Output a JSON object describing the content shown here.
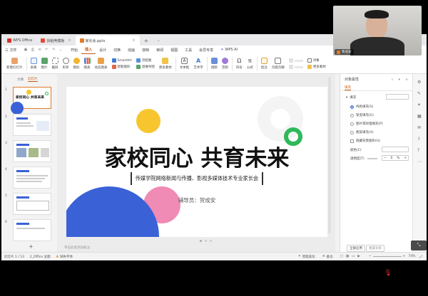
{
  "tabs": [
    {
      "label": "WPS Office",
      "color": "#d0312d"
    },
    {
      "label": "找稻壳模板",
      "color": "#e04a3a"
    },
    {
      "label": "家长会.pptx",
      "color": "#e07b2a"
    }
  ],
  "menus": [
    "三 文件",
    "开始",
    "插入",
    "设计",
    "切换",
    "动画",
    "放映",
    "审阅",
    "视图",
    "工具",
    "会员专享",
    "WPS AI"
  ],
  "ribbon": {
    "new_slide": "新建幻灯片",
    "table": "表格",
    "picture": "图片",
    "screenshot": "截屏",
    "shape": "形状",
    "icon": "图标",
    "chart": "图表",
    "dynamic_chart": "动态图表",
    "smartart": "SmartArt",
    "smart_shape": "智能图形",
    "flowchart": "流程图",
    "mindmap": "思维导图",
    "more_material": "更多素材",
    "textbox": "文本框",
    "art_text": "艺术字",
    "video": "视频",
    "audio": "音频",
    "symbol": "符号",
    "formula": "公式",
    "annotation": "批注",
    "page_header": "页眉页脚",
    "object": "对象",
    "more_material2": "更多素材"
  },
  "left_panel": {
    "tab_outline": "大纲",
    "tab_slides": "幻灯片",
    "add": "+"
  },
  "slides": [
    {
      "num": "1",
      "title": "家校同心 共育未来"
    },
    {
      "num": "2"
    },
    {
      "num": "3"
    },
    {
      "num": "4"
    },
    {
      "num": "5"
    },
    {
      "num": "6"
    }
  ],
  "slide": {
    "title": "家校同心  共育未来",
    "subtitle": "传媒学院网络新闻与传播、影视多媒体技术专业家长会",
    "counselor": "辅导员：贺成安"
  },
  "notes_placeholder": "单击此处添加备注",
  "right_pane": {
    "title": "对象属性",
    "tab_fill": "填充",
    "fill_label": "填充",
    "options": [
      "纯色填充(S)",
      "渐变填充(G)",
      "图片或纹理填充(P)",
      "图案填充(A)"
    ],
    "selected_option": 0,
    "hide_bg": "隐藏背景图形(H)",
    "color_label": "颜色(C)",
    "transparency_label": "透明度(T)",
    "transparency_value": "0",
    "transparency_unit": "%",
    "apply_all": "全部应用",
    "reset_bg": "重置背景"
  },
  "status": {
    "slide_count": "幻灯片 1 / 13",
    "theme": "2_Office 主题",
    "font_missing": "缺失字体",
    "smart_beauty": "智能美化",
    "notes": "备注",
    "zoom": "74%"
  },
  "video": {
    "name": "贺成安"
  },
  "colors": {
    "accent": "#c55a11",
    "blue": "#3a62d6",
    "yellow": "#f7c62f",
    "pink": "#ef8bb5",
    "green": "#2fb85a"
  }
}
